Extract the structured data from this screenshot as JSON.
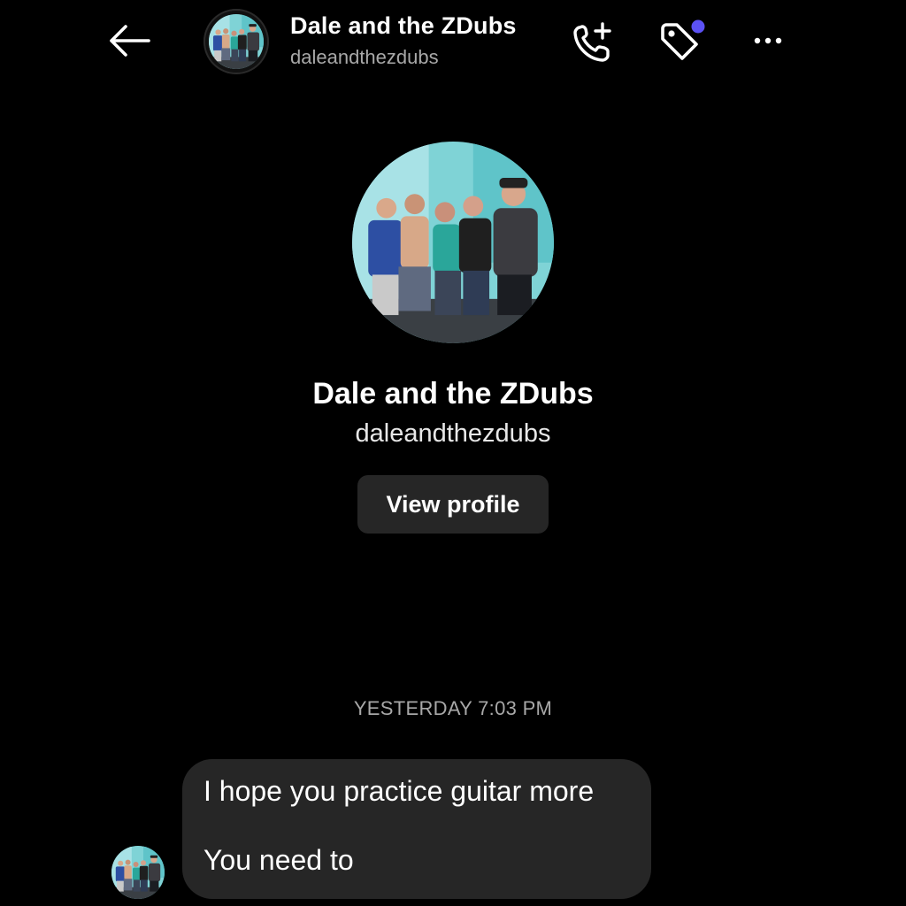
{
  "header": {
    "back_icon": "arrow-left-icon",
    "title": "Dale and the ZDubs",
    "handle": "daleandthezdubs",
    "call_icon": "phone-plus-icon",
    "tag_icon": "tag-icon",
    "tag_badge_color": "#5b51f5",
    "more_icon": "more-horizontal-icon"
  },
  "profile": {
    "name": "Dale and the ZDubs",
    "handle": "daleandthezdubs",
    "view_profile_label": "View profile"
  },
  "conversation": {
    "timestamp": "YESTERDAY 7:03 PM",
    "messages": [
      {
        "lines": [
          "I hope you practice guitar more",
          "You need to"
        ]
      }
    ]
  },
  "colors": {
    "background": "#000000",
    "bubble": "#262626",
    "secondary_text": "#a8a8a8"
  }
}
